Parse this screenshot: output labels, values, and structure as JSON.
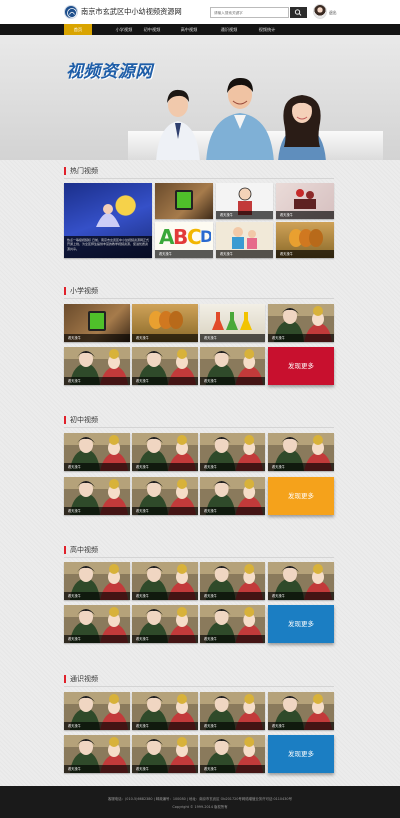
{
  "header": {
    "site_title": "南京市玄武区中小幼视频资源网",
    "search_placeholder": "请输入搜索关键字",
    "user_name": "退出"
  },
  "nav": {
    "items": [
      "首页",
      "小学视频",
      "初中视频",
      "高中视频",
      "通识视频",
      "视频统计"
    ],
    "active_index": 0,
    "active_color": "#d9a400"
  },
  "banner": {
    "title": "视频资源网"
  },
  "sections": {
    "hot": {
      "title": "热门视频",
      "featured_desc": "热点一等级视频标 日前，南京市玄武区中小幼视频资源网正式开通上线，为全区师生提供丰富的教学视频资源，促进优质资源共享。"
    },
    "primary": {
      "title": "小学视频",
      "more_label": "发现更多",
      "more_color": "#c8102e"
    },
    "junior": {
      "title": "初中视频",
      "more_label": "发现更多",
      "more_color": "#f5a21b"
    },
    "senior": {
      "title": "高中视频",
      "more_label": "发现更多",
      "more_color": "#1b7ec3"
    },
    "general": {
      "title": "通识视频",
      "more_label": "发现更多",
      "more_color": "#1b7ec3"
    }
  },
  "thumb_caption": "看天找牛",
  "footer": {
    "line1": "客服电话：(010-5)6682380 | 邮政编号：100080 | 地址：南京市玄武区 Ob201720号网络增值业务许可证:0110430号",
    "line2": "Copyright © 1999-2014 版权所有"
  }
}
